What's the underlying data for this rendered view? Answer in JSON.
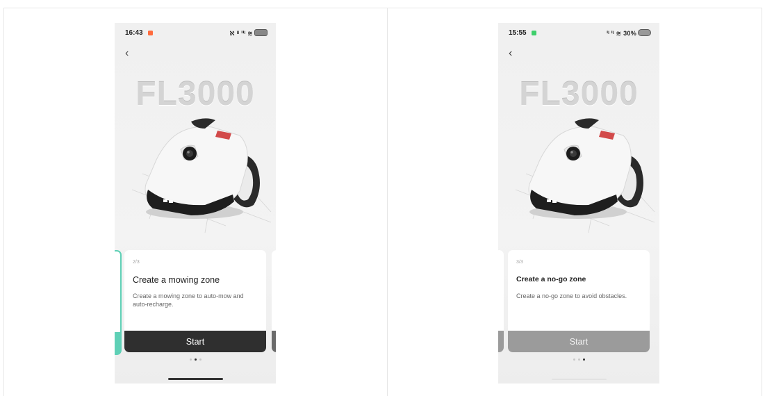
{
  "screens": [
    {
      "status": {
        "time": "16:43",
        "right": "‹ᴺ² ᵍᴸ •• ≋",
        "notif_color": "#ff6b3d"
      },
      "hero": "FL3000",
      "card": {
        "step": "2/3",
        "title": "Create a mowing zone",
        "desc": "Create a mowing zone to auto-mow and auto-recharge.",
        "button": "Start"
      },
      "pager": {
        "count": 3,
        "active": 1
      }
    },
    {
      "status": {
        "time": "15:55",
        "right": "ᴺ² ᴺ² ≋ 30%",
        "notif_color": "#3ecf6b"
      },
      "hero": "FL3000",
      "card": {
        "step": "3/3",
        "title": "Create a no-go zone",
        "desc": "Create a no-go zone to avoid obstacles.",
        "button": "Start"
      },
      "pager": {
        "count": 3,
        "active": 2
      }
    }
  ],
  "colors": {
    "accent": "#5fd0b6",
    "button_active": "#2f2f2f",
    "button_disabled": "#9b9b9b"
  }
}
